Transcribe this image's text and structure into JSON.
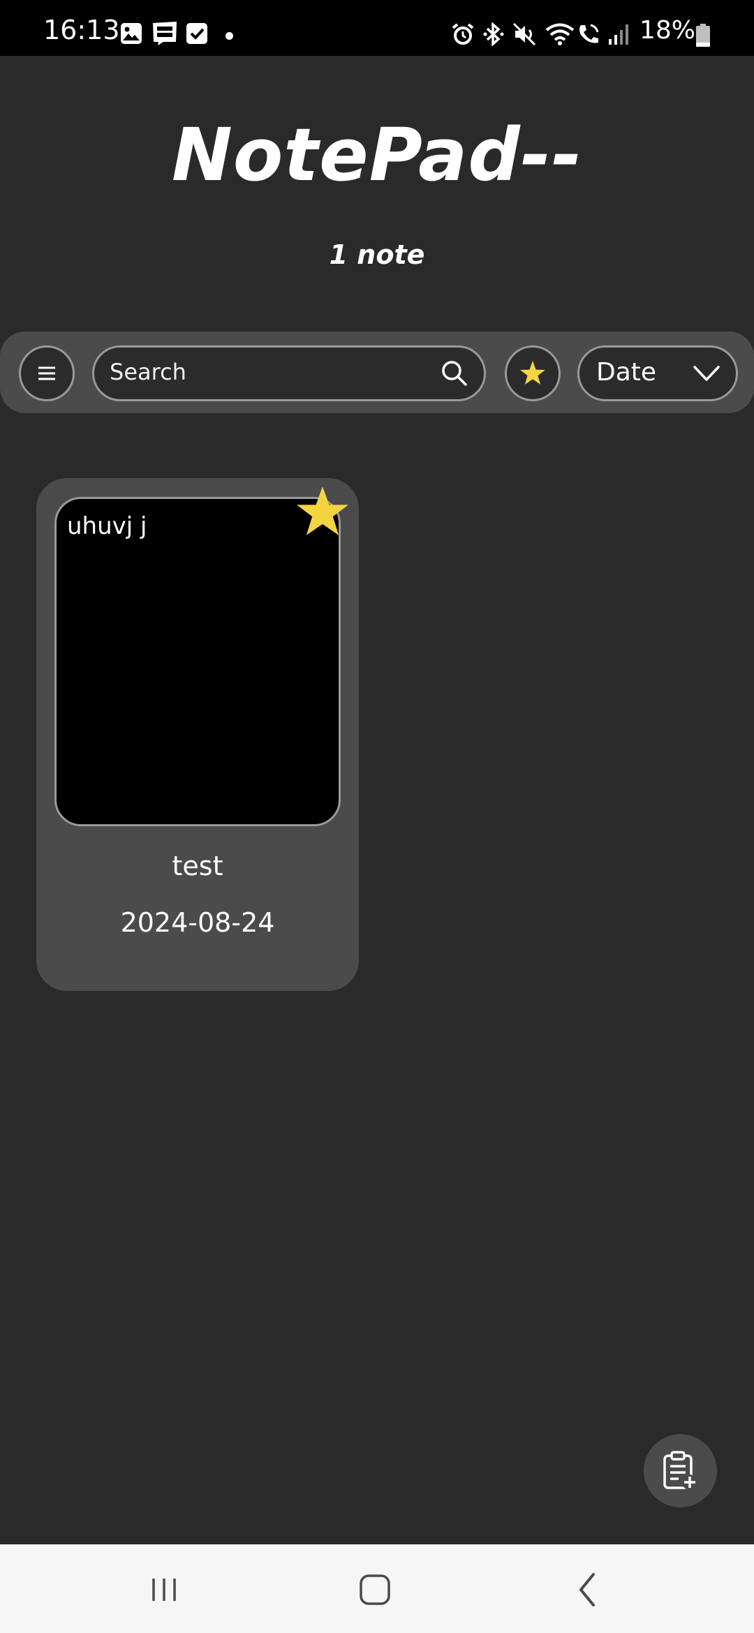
{
  "status_bar": {
    "time": "16:13",
    "battery": "18%",
    "notification_icons": [
      "image-icon",
      "webtoon-icon",
      "checkbox-icon"
    ],
    "system_icons": [
      "alarm-icon",
      "bluetooth-icon",
      "mute-icon",
      "wifi-icon",
      "wifi-calling-icon",
      "signal-icon",
      "battery-icon"
    ]
  },
  "header": {
    "title": "NotePad--",
    "note_count": "1 note"
  },
  "toolbar": {
    "search_placeholder": "Search",
    "sort_value": "Date",
    "favorite_star_color": "#f5d442"
  },
  "notes": [
    {
      "preview": "uhuvj j",
      "title": "test",
      "date": "2024-08-24",
      "favorite": true
    }
  ],
  "colors": {
    "background": "#2a2a2a",
    "surface": "#4b4b4b",
    "star": "#f5d442",
    "border": "#9a9a9a"
  }
}
